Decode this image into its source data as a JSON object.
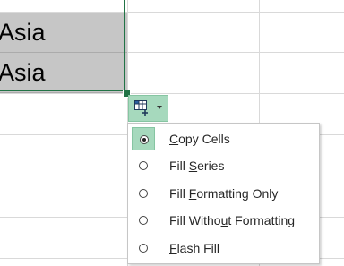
{
  "sheet": {
    "cells": [
      "Asia",
      "Asia"
    ],
    "accent_color": "#217346",
    "selected_cell_bg": "#c6c6c6"
  },
  "autofill_button": {
    "icon": "autofill-options-icon",
    "dropdown_icon": "chevron-down-icon",
    "bg_color": "#a6d9bd"
  },
  "autofill_menu": {
    "selected_index": 0,
    "items": [
      {
        "pre": "",
        "key": "C",
        "post": "opy Cells",
        "label": "Copy Cells"
      },
      {
        "pre": "Fill ",
        "key": "S",
        "post": "eries",
        "label": "Fill Series"
      },
      {
        "pre": "Fill ",
        "key": "F",
        "post": "ormatting Only",
        "label": "Fill Formatting Only"
      },
      {
        "pre": "Fill Witho",
        "key": "u",
        "post": "t Formatting",
        "label": "Fill Without Formatting"
      },
      {
        "pre": "",
        "key": "F",
        "post": "lash Fill",
        "label": "Flash Fill"
      }
    ]
  }
}
